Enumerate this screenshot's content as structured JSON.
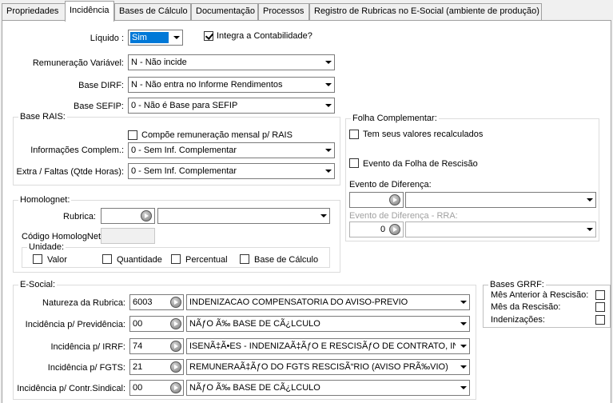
{
  "tabs": [
    "Propriedades",
    "Incidência",
    "Bases de Cálculo",
    "Documentação",
    "Processos",
    "Registro de Rubricas no E-Social (ambiente de produção)"
  ],
  "top": {
    "liquido_label": "Líquido :",
    "liquido_value": "Sim",
    "integra_label": "Integra a Contabilidade?",
    "remun_label": "Remuneração Variável:",
    "remun_value": "N - Não incide",
    "dirf_label": "Base DIRF:",
    "dirf_value": "N - Não entra no Informe Rendimentos",
    "sefip_label": "Base SEFIP:",
    "sefip_value": "0 - Não é Base para SEFIP"
  },
  "rais": {
    "title": "Base RAIS:",
    "compoe_label": "Compõe remuneração mensal p/ RAIS",
    "info_label": "Informações Complem.:",
    "info_value": "0 - Sem Inf. Complementar",
    "extra_label": "Extra / Faltas (Qtde Horas):",
    "extra_value": "0 - Sem Inf. Complementar"
  },
  "homolog": {
    "title": "Homolognet:",
    "rubrica_label": "Rubrica:",
    "codigo_label": "Código HomologNet",
    "unidade_title": "Unidade:",
    "valor": "Valor",
    "quantidade": "Quantidade",
    "percentual": "Percentual",
    "base_calculo": "Base de Cálculo"
  },
  "folha": {
    "title": "Folha Complementar:",
    "recalc_label": "Tem seus valores recalculados",
    "rescisao_label": "Evento da Folha de Rescisão",
    "diferenca_label": "Evento de Diferença:",
    "rra_label": "Evento de Diferença - RRA:",
    "rra_value": "0"
  },
  "esocial": {
    "title": "E-Social:",
    "rows": [
      {
        "label": "Natureza da Rubrica:",
        "code": "6003",
        "desc": "INDENIZACAO COMPENSATORIA DO AVISO-PREVIO"
      },
      {
        "label": "Incidência p/ Previdência:",
        "code": "00",
        "desc": "NÃƒO Ã‰ BASE DE CÃ¿LCULO"
      },
      {
        "label": "Incidência p/ IRRF:",
        "code": "74",
        "desc": "ISENÃ‡Ã•ES - INDENIZAÃ‡ÃƒO E RESCISÃƒO DE CONTRATO, INCLU"
      },
      {
        "label": "Incidência p/ FGTS:",
        "code": "21",
        "desc": "REMUNERAÃ‡ÃƒO DO FGTS RESCISÃ“RIO (AVISO PRÃ‰VIO)"
      },
      {
        "label": "Incidência p/ Contr.Sindical:",
        "code": "00",
        "desc": "NÃƒO Ã‰ BASE DE CÃ¿LCULO"
      }
    ]
  },
  "grrf": {
    "title": "Bases GRRF:",
    "mes_anterior": "Mês Anterior à Rescisão:",
    "mes_rescisao": "Mês da Rescisão:",
    "indenizacoes": "Indenizações:"
  },
  "colors": {
    "accent": "#0078d7",
    "panel": "#ffffff",
    "chrome": "#f0f0f0"
  }
}
